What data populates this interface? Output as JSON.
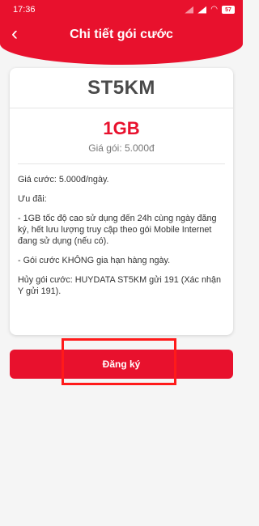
{
  "status_bar": {
    "time": "17:36",
    "battery": "57",
    "icons": [
      "signal-icon",
      "signal-icon",
      "wifi-icon",
      "battery-icon"
    ]
  },
  "header": {
    "back_icon": "chevron-left-icon",
    "title": "Chi tiết gói cước"
  },
  "package": {
    "name": "ST5KM",
    "data_amount": "1GB",
    "price_line": "Giá gói: 5.000đ",
    "details": [
      "Giá cước: 5.000đ/ngày.",
      "Ưu đãi:",
      "- 1GB tốc độ cao sử dụng đến 24h cùng ngày đăng ký, hết lưu lượng truy cập theo gói Mobile Internet đang sử dụng (nếu có).",
      "- Gói cước KHÔNG gia hạn hàng ngày.",
      "Hủy gói cước: HUYDATA ST5KM gửi 191 (Xác nhận Y gửi 191)."
    ]
  },
  "actions": {
    "register_label": "Đăng ký"
  },
  "colors": {
    "brand": "#e8112d",
    "highlight_border": "#ff1a1a"
  }
}
